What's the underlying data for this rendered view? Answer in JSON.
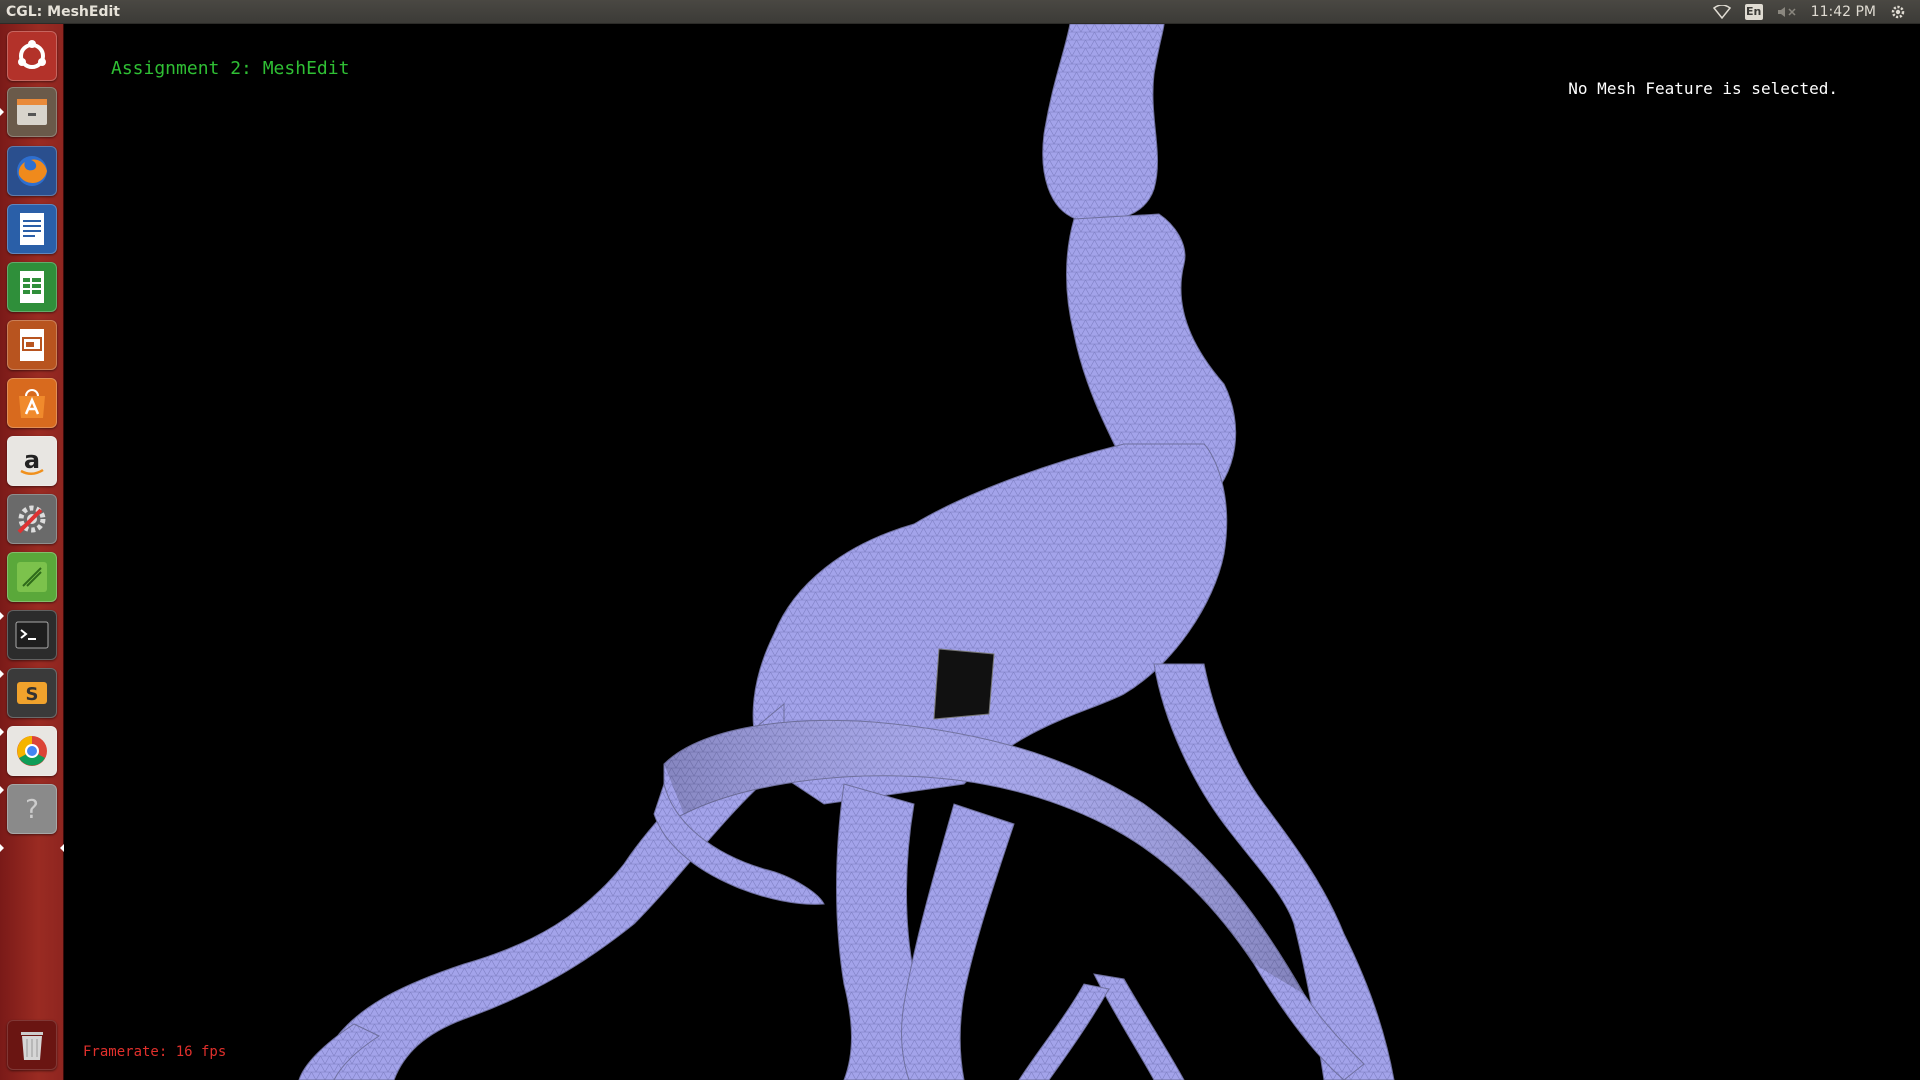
{
  "top_panel": {
    "window_title": "CGL: MeshEdit",
    "language": "En",
    "clock": "11:42 PM",
    "icons": [
      "wifi-icon",
      "keyboard-language-icon",
      "volume-muted-icon",
      "session-gear-icon"
    ]
  },
  "launcher": {
    "items": [
      {
        "name": "dash-home",
        "icon": "ubuntu-logo-icon"
      },
      {
        "name": "files",
        "icon": "file-cabinet-icon"
      },
      {
        "name": "firefox",
        "icon": "firefox-icon"
      },
      {
        "name": "libreoffice-writer",
        "icon": "writer-document-icon"
      },
      {
        "name": "libreoffice-calc",
        "icon": "calc-spreadsheet-icon"
      },
      {
        "name": "libreoffice-impress",
        "icon": "impress-presentation-icon"
      },
      {
        "name": "ubuntu-software-center",
        "icon": "software-bag-icon"
      },
      {
        "name": "amazon",
        "icon": "amazon-icon"
      },
      {
        "name": "system-settings",
        "icon": "settings-tools-icon"
      },
      {
        "name": "green-app",
        "icon": "green-app-icon"
      },
      {
        "name": "terminal",
        "icon": "terminal-icon"
      },
      {
        "name": "sublime-text",
        "icon": "sublime-text-icon"
      },
      {
        "name": "chrome",
        "icon": "chrome-icon"
      },
      {
        "name": "unknown-app",
        "icon": "question-mark-icon"
      },
      {
        "name": "trash",
        "icon": "trash-icon"
      }
    ],
    "accent_color": "#9a2b22"
  },
  "viewport": {
    "assignment_title": "Assignment 2: MeshEdit",
    "selection_status": "No Mesh Feature is selected.",
    "framerate": "Framerate: 16 fps",
    "mesh_color": "#9f9fe6",
    "title_color": "#2fbf34",
    "framerate_color": "#e0302c"
  }
}
